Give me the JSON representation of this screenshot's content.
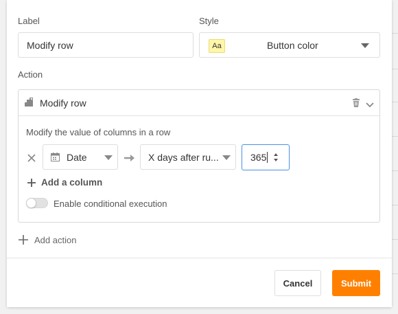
{
  "style_section": {
    "label_heading": "Label",
    "label_value": "Modify row",
    "style_heading": "Style",
    "style_chip": "Aa",
    "style_value": "Button color"
  },
  "action_section": {
    "heading": "Action",
    "action_type": "Modify row",
    "description": "Modify the value of columns in a row",
    "column_select": "Date",
    "mode_select": "X days after ru...",
    "days_value": "365",
    "add_column": "Add a column",
    "conditional_label": "Enable conditional execution",
    "conditional_enabled": false,
    "add_action": "Add action"
  },
  "footer": {
    "cancel": "Cancel",
    "submit": "Submit"
  },
  "colors": {
    "accent": "#ff8000",
    "focus_border": "#4a90e2",
    "chip_bg": "#fff6a8"
  }
}
